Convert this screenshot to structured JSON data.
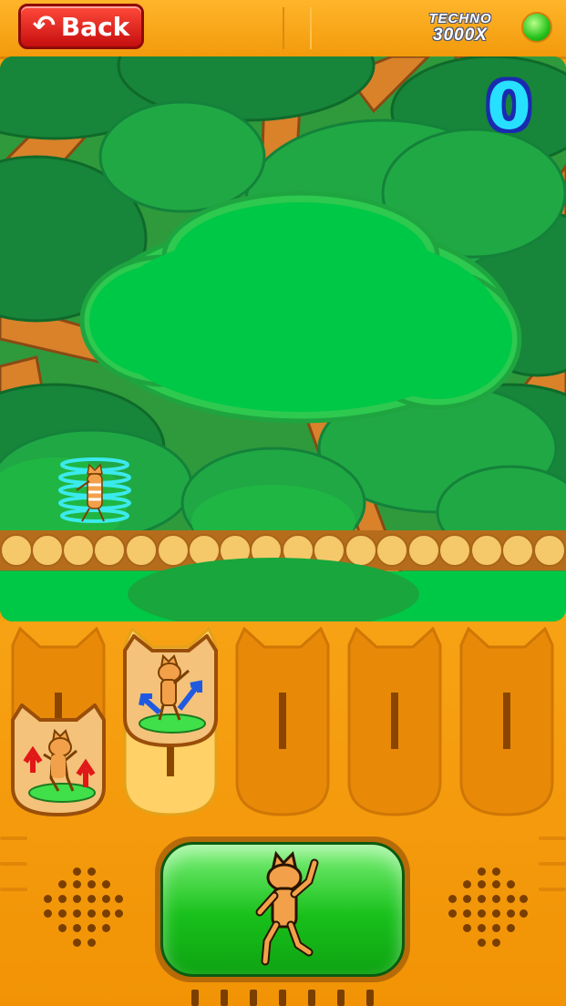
{
  "header": {
    "back_label": "Back",
    "back_icon": "return-arrow-icon",
    "brand_line1": "TECHNO",
    "brand_line2": "3000X",
    "status_led_color": "#27c21b"
  },
  "game": {
    "score": "0",
    "scene": "forest",
    "character": "cat"
  },
  "move_slots": [
    {
      "index": 1,
      "move": "cat-raise-arms-red-arrows-icon",
      "active": false
    },
    {
      "index": 2,
      "move": "cat-wave-blue-arrows-icon",
      "active": true
    },
    {
      "index": 3,
      "move": null,
      "active": false
    },
    {
      "index": 4,
      "move": null,
      "active": false
    },
    {
      "index": 5,
      "move": null,
      "active": false
    }
  ],
  "controls": {
    "dance_button_icon": "dancing-cat-icon"
  },
  "colors": {
    "body_orange": "#f7a214",
    "back_red": "#d41515",
    "score_cyan": "#27e0ff",
    "dance_green": "#18c01b"
  }
}
